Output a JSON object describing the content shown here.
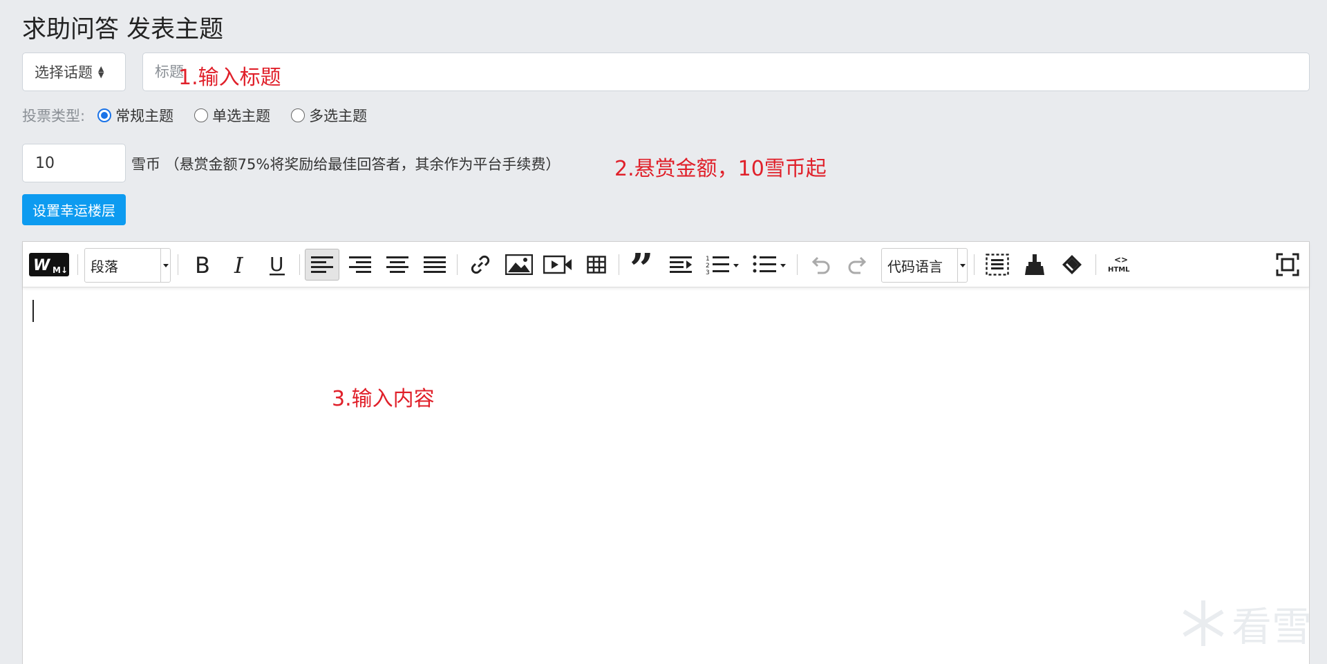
{
  "page": {
    "title": "求助问答 发表主题"
  },
  "topic_select": {
    "label": "选择话题"
  },
  "title_field": {
    "placeholder": "标题"
  },
  "annotations": {
    "step1": "1.输入标题",
    "step2": "2.悬赏金额，10雪币起",
    "step3": "3.输入内容"
  },
  "vote": {
    "label": "投票类型:",
    "options": [
      {
        "label": "常规主题",
        "checked": true
      },
      {
        "label": "单选主题",
        "checked": false
      },
      {
        "label": "多选主题",
        "checked": false
      }
    ]
  },
  "reward": {
    "value": "10",
    "unit_note": "雪币 （悬赏金额75%将奖励给最佳回答者，其余作为平台手续费）"
  },
  "lucky_button": {
    "label": "设置幸运楼层"
  },
  "toolbar": {
    "logo_icon": "wm-markdown-icon",
    "paragraph_select": "段落",
    "code_lang_select": "代码语言",
    "icons": [
      "bold-icon",
      "italic-icon",
      "underline-icon",
      "align-left-icon",
      "align-right-icon",
      "align-center-icon",
      "align-justify-icon",
      "link-icon",
      "image-icon",
      "video-icon",
      "table-icon",
      "blockquote-icon",
      "indent-icon",
      "ordered-list-icon",
      "unordered-list-icon",
      "undo-icon",
      "redo-icon",
      "select-all-icon",
      "format-painter-icon",
      "eraser-icon",
      "html-icon",
      "fullscreen-icon"
    ],
    "html_label": "HTML"
  },
  "watermark": {
    "text": "看雪"
  },
  "colors": {
    "accent": "#0d9bf0",
    "annotation": "#e0202a",
    "radio": "#1a73e8",
    "background": "#e9ebee"
  }
}
